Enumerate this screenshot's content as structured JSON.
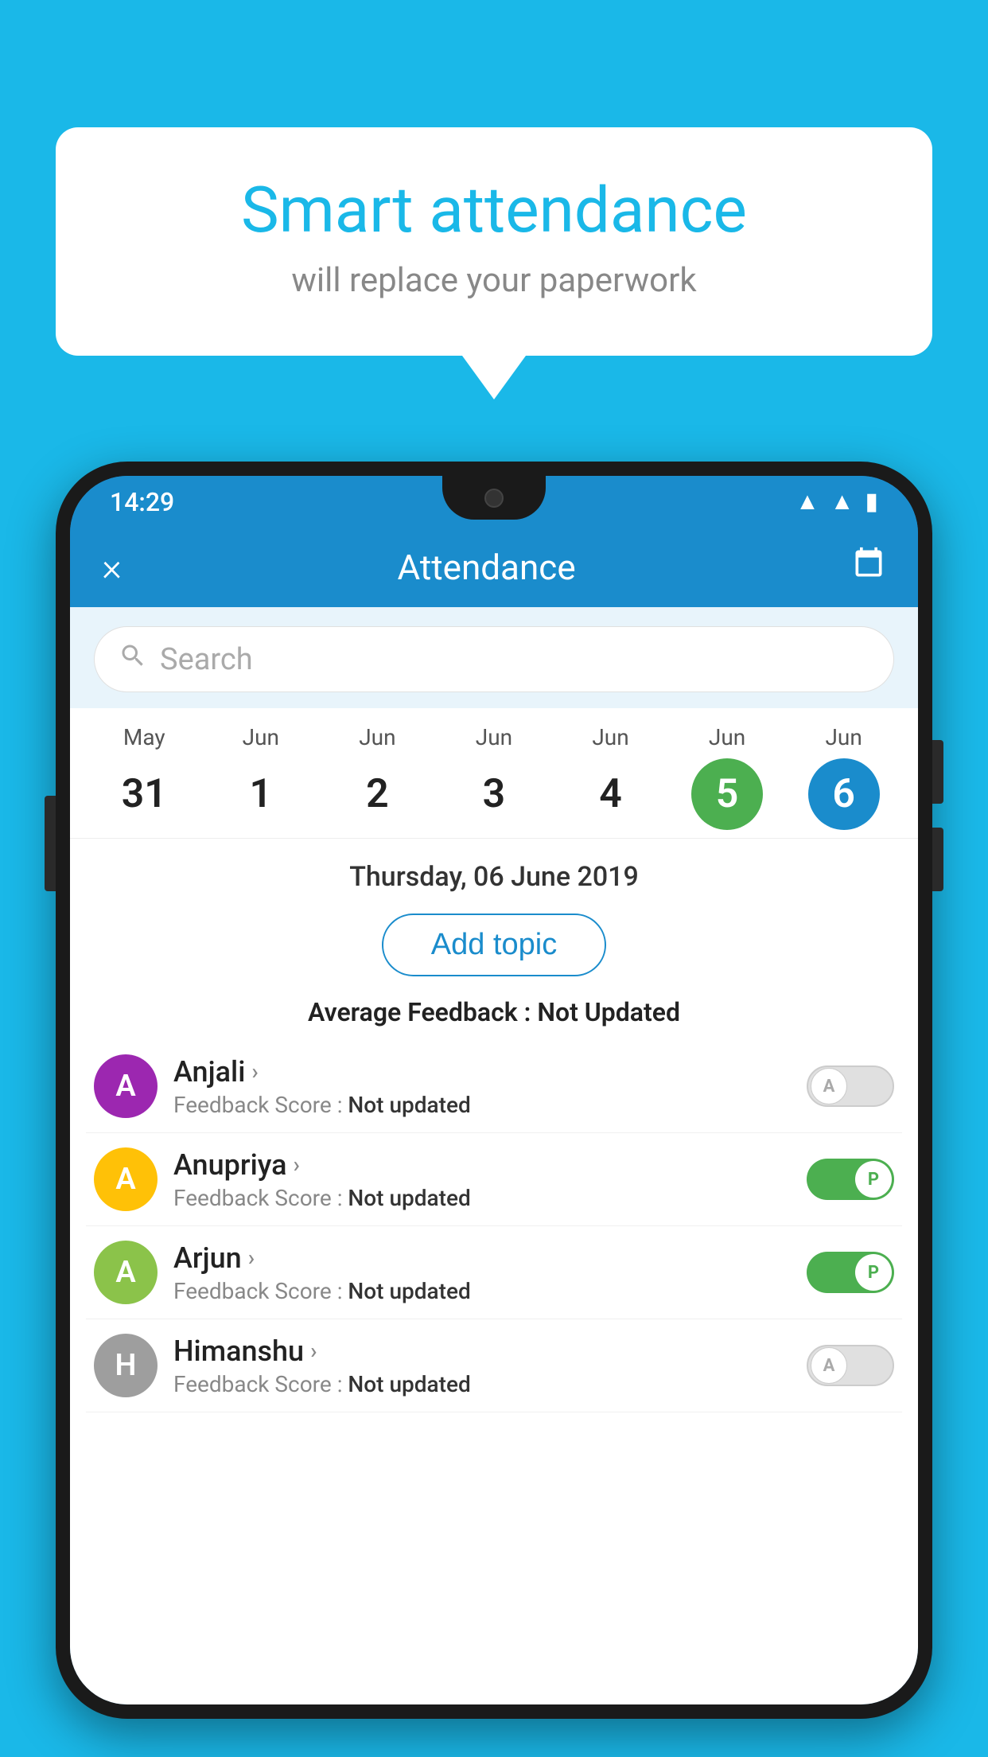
{
  "background_color": "#1ab8e8",
  "speech_bubble": {
    "title": "Smart attendance",
    "subtitle": "will replace your paperwork"
  },
  "status_bar": {
    "time": "14:29",
    "icons": [
      "wifi",
      "signal",
      "battery"
    ]
  },
  "app_header": {
    "close_label": "×",
    "title": "Attendance",
    "calendar_icon": "📅"
  },
  "search": {
    "placeholder": "Search"
  },
  "date_strip": {
    "dates": [
      {
        "month": "May",
        "day": "31",
        "state": "normal"
      },
      {
        "month": "Jun",
        "day": "1",
        "state": "normal"
      },
      {
        "month": "Jun",
        "day": "2",
        "state": "normal"
      },
      {
        "month": "Jun",
        "day": "3",
        "state": "normal"
      },
      {
        "month": "Jun",
        "day": "4",
        "state": "normal"
      },
      {
        "month": "Jun",
        "day": "5",
        "state": "today"
      },
      {
        "month": "Jun",
        "day": "6",
        "state": "selected"
      }
    ]
  },
  "selected_date": "Thursday, 06 June 2019",
  "add_topic_label": "Add topic",
  "avg_feedback_label": "Average Feedback : ",
  "avg_feedback_value": "Not Updated",
  "students": [
    {
      "name": "Anjali",
      "avatar_letter": "A",
      "avatar_color": "#9c27b0",
      "feedback_label": "Feedback Score : ",
      "feedback_value": "Not updated",
      "toggle_state": "off",
      "toggle_letter": "A"
    },
    {
      "name": "Anupriya",
      "avatar_letter": "A",
      "avatar_color": "#ffc107",
      "feedback_label": "Feedback Score : ",
      "feedback_value": "Not updated",
      "toggle_state": "on",
      "toggle_letter": "P"
    },
    {
      "name": "Arjun",
      "avatar_letter": "A",
      "avatar_color": "#8bc34a",
      "feedback_label": "Feedback Score : ",
      "feedback_value": "Not updated",
      "toggle_state": "on",
      "toggle_letter": "P"
    },
    {
      "name": "Himanshu",
      "avatar_letter": "H",
      "avatar_color": "#9e9e9e",
      "feedback_label": "Feedback Score : ",
      "feedback_value": "Not updated",
      "toggle_state": "off",
      "toggle_letter": "A"
    }
  ]
}
